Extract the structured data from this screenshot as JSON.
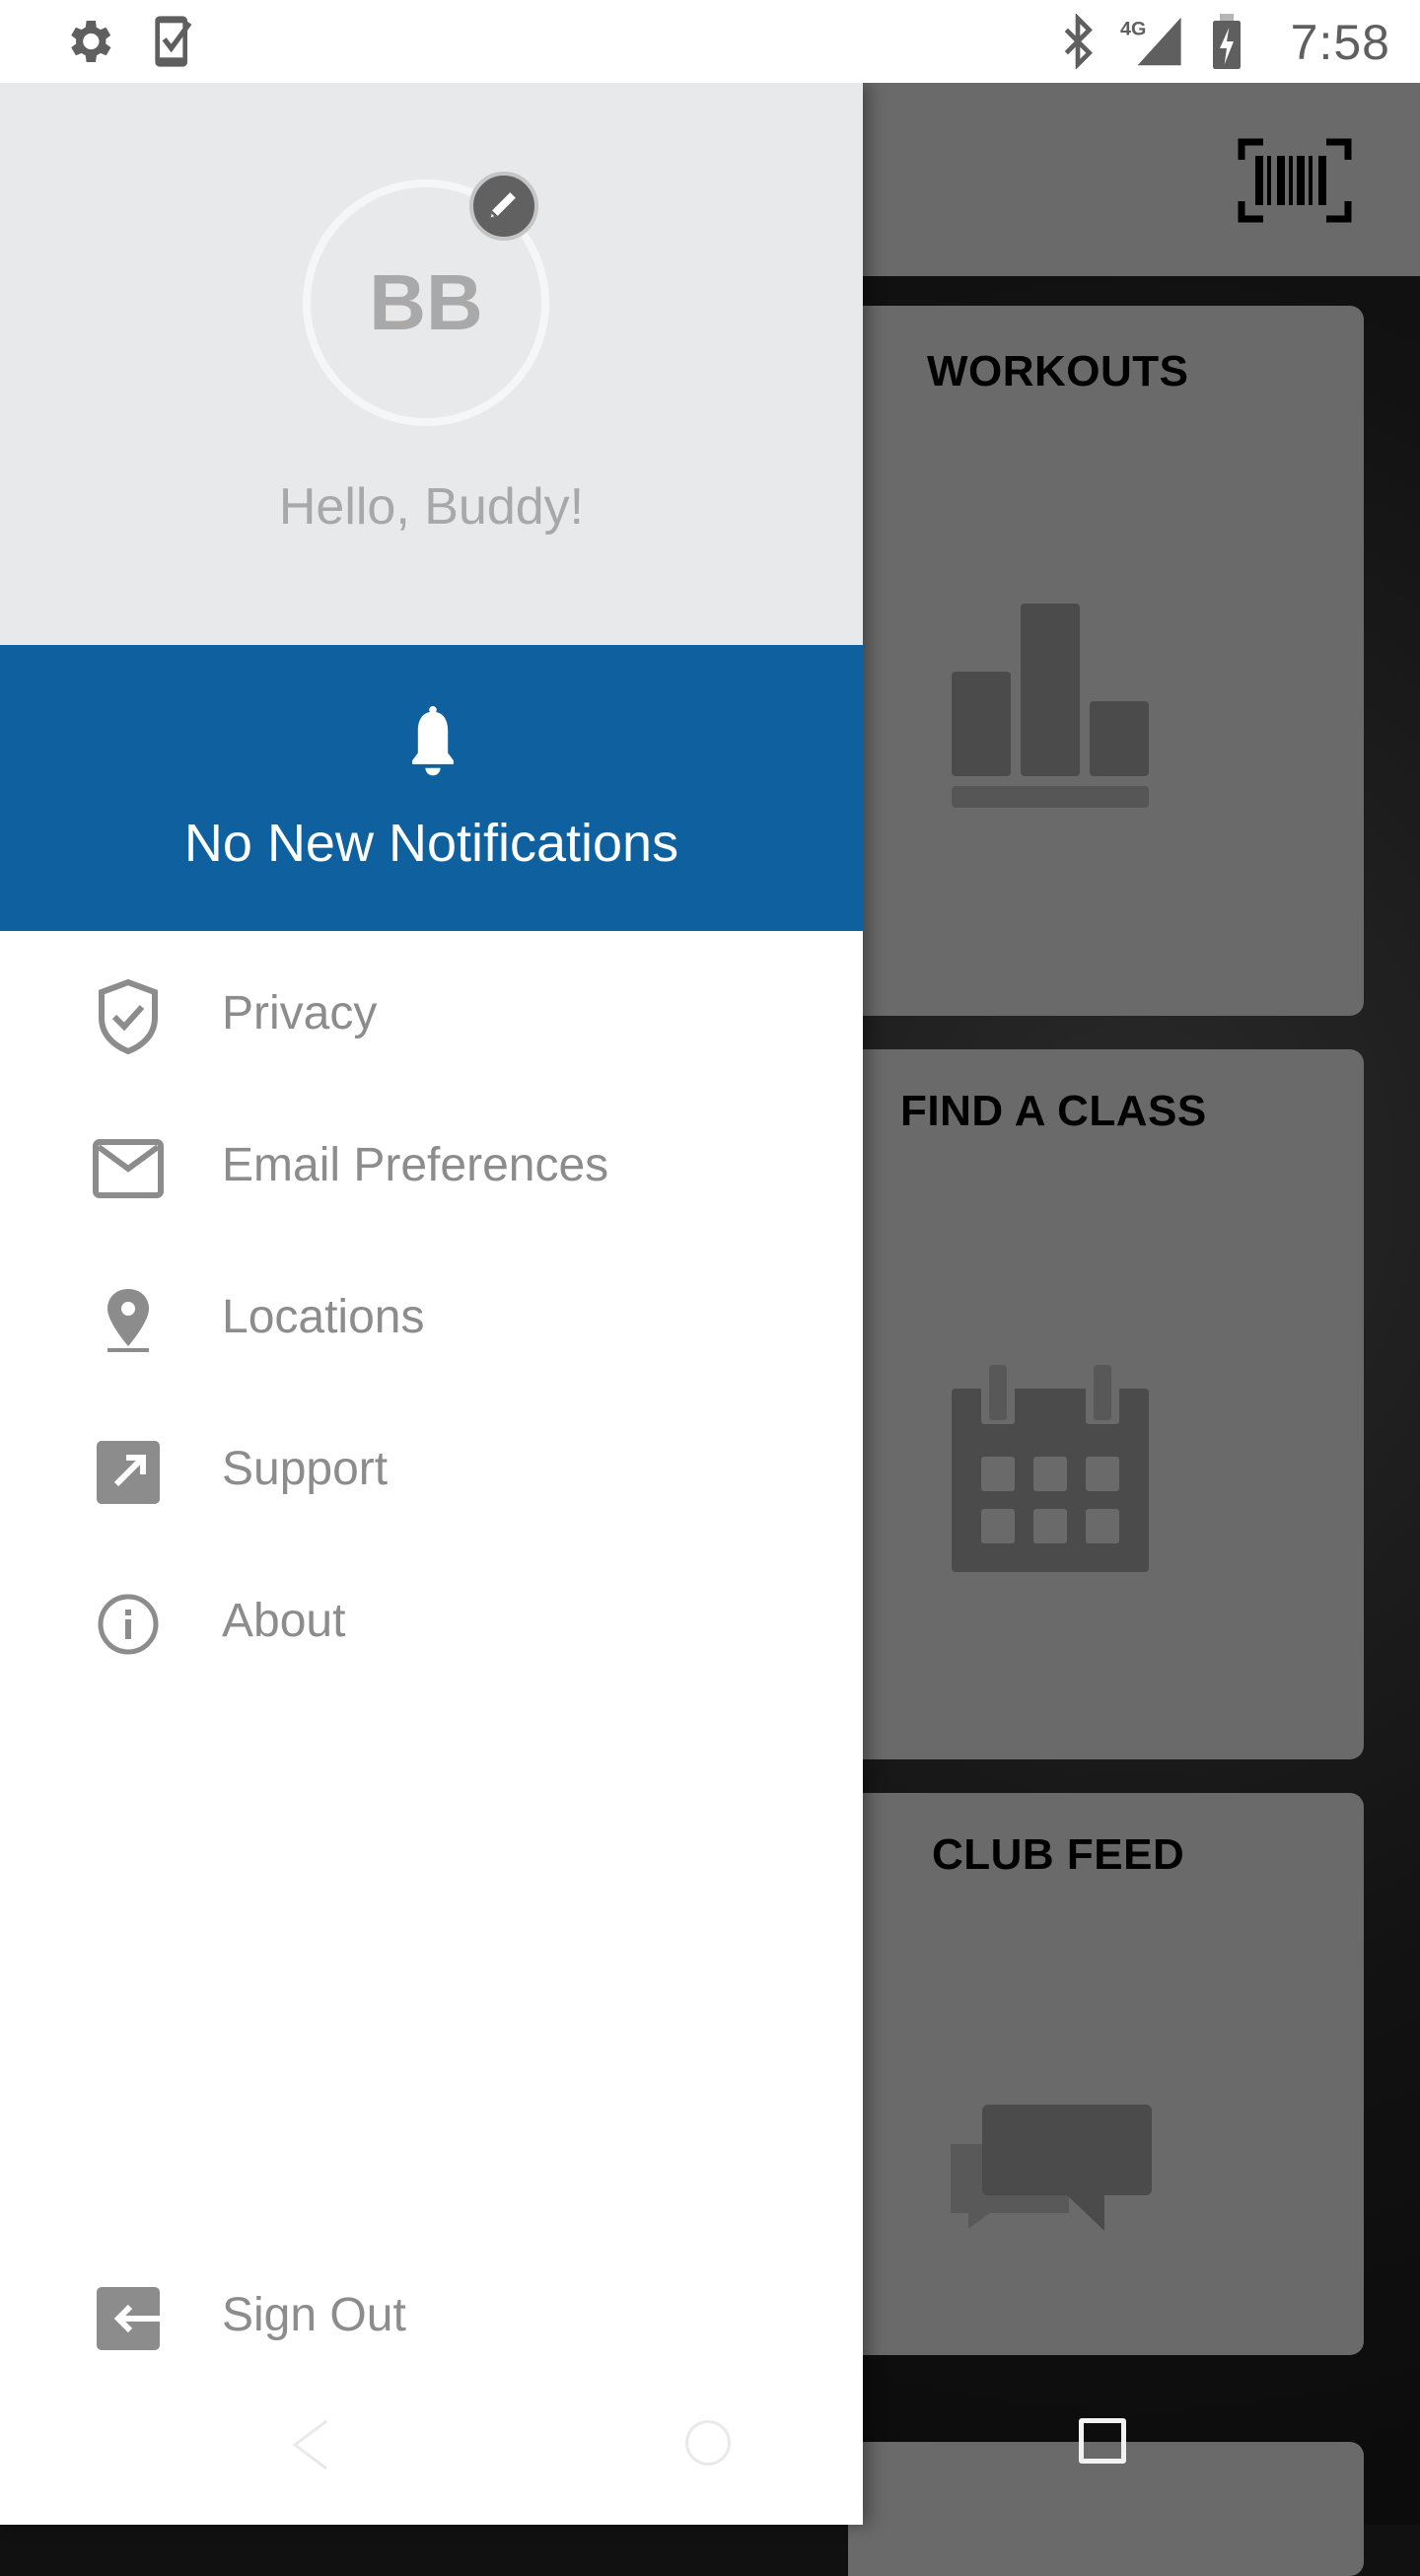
{
  "status_bar": {
    "left_icons": [
      "settings-gear-icon",
      "phone-checklist-icon"
    ],
    "right_icons": [
      "bluetooth-icon",
      "signal-4g-icon",
      "battery-charging-icon"
    ],
    "network_label": "4G",
    "time": "7:58"
  },
  "background_app": {
    "toolbar": {
      "barcode_icon": "barcode-scan-icon"
    },
    "tiles": [
      {
        "title": "WORKOUTS",
        "icon": "bar-chart-icon"
      },
      {
        "title": "FIND A CLASS",
        "icon": "calendar-icon"
      },
      {
        "title": "CLUB FEED",
        "icon": "chat-bubbles-icon"
      }
    ]
  },
  "drawer": {
    "profile": {
      "initials": "BB",
      "greeting": "Hello, Buddy!",
      "edit_icon": "pencil-icon"
    },
    "notifications": {
      "icon": "bell-icon",
      "text": "No New Notifications",
      "background": "#0E619E"
    },
    "menu": [
      {
        "label": "Privacy",
        "icon": "shield-check-icon"
      },
      {
        "label": "Email Preferences",
        "icon": "envelope-icon"
      },
      {
        "label": "Locations",
        "icon": "map-pin-icon"
      },
      {
        "label": "Support",
        "icon": "external-link-icon"
      },
      {
        "label": "About",
        "icon": "info-circle-icon"
      }
    ],
    "sign_out": {
      "label": "Sign Out",
      "icon": "sign-out-icon"
    }
  },
  "nav_bar": {
    "buttons": [
      "back",
      "home",
      "recents"
    ]
  },
  "colors": {
    "accent": "#0E619E",
    "menu_text": "#8C8C8C",
    "header_bg": "#E8E9EB",
    "scrim_tile": "#6A6A6A"
  }
}
